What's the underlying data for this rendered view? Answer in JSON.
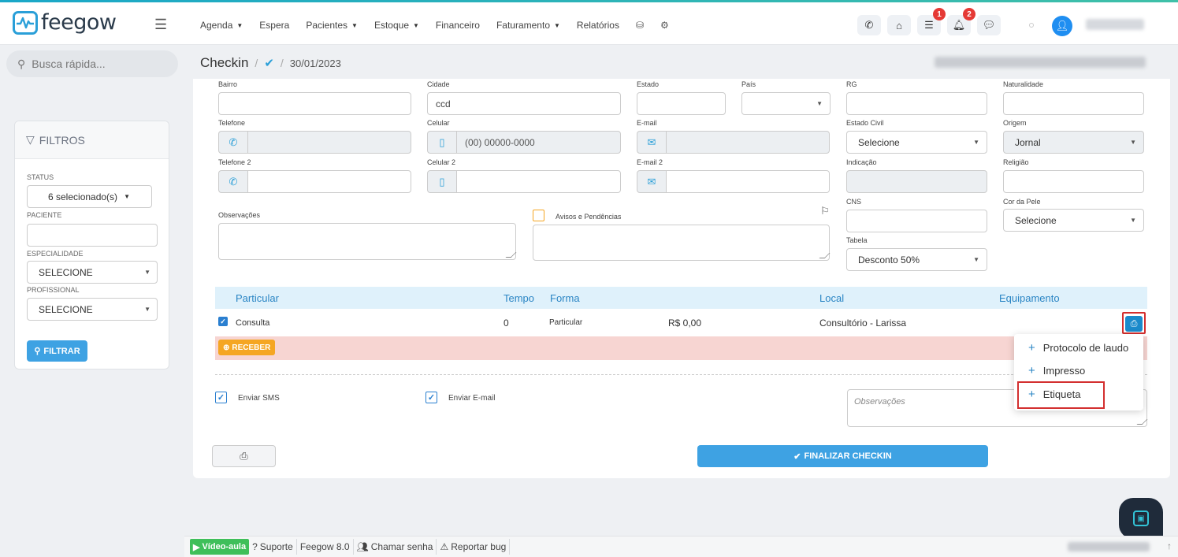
{
  "brand": {
    "name": "feegow"
  },
  "nav": {
    "items": [
      {
        "label": "Agenda",
        "has_caret": true
      },
      {
        "label": "Espera",
        "has_caret": false
      },
      {
        "label": "Pacientes",
        "has_caret": true
      },
      {
        "label": "Estoque",
        "has_caret": true
      },
      {
        "label": "Financeiro",
        "has_caret": false
      },
      {
        "label": "Faturamento",
        "has_caret": true
      },
      {
        "label": "Relatórios",
        "has_caret": false
      }
    ],
    "icons": [
      "database-icon",
      "gear-icon"
    ]
  },
  "header_badges": {
    "tasks": "1",
    "notifications": "2"
  },
  "search": {
    "placeholder": "Busca rápida..."
  },
  "filters": {
    "title": "FILTROS",
    "status_label": "STATUS",
    "status_value": "6 selecionado(s)",
    "paciente_label": "PACIENTE",
    "especialidade_label": "ESPECIALIDADE",
    "especialidade_value": "SELECIONE",
    "profissional_label": "PROFISSIONAL",
    "profissional_value": "SELECIONE",
    "filter_button": "FILTRAR"
  },
  "breadcrumb": {
    "title": "Checkin",
    "sep": "/",
    "date": "30/01/2023"
  },
  "form": {
    "bairro": "Bairro",
    "cidade": "Cidade",
    "cidade_value": "ccd",
    "estado": "Estado",
    "pais": "País",
    "rg": "RG",
    "naturalidade": "Naturalidade",
    "telefone": "Telefone",
    "celular": "Celular",
    "celular_placeholder": "(00) 00000-0000",
    "email": "E-mail",
    "estado_civil": "Estado Civil",
    "estado_civil_value": "Selecione",
    "origem": "Origem",
    "origem_value": "Jornal",
    "telefone2": "Telefone 2",
    "celular2": "Celular 2",
    "email2": "E-mail 2",
    "indicacao": "Indicação",
    "religiao": "Religião",
    "cns": "CNS",
    "cor_pele": "Cor da Pele",
    "cor_pele_value": "Selecione",
    "observacoes": "Observações",
    "avisos": "Avisos e Pendências",
    "tabela": "Tabela",
    "tabela_value": "Desconto 50%"
  },
  "table": {
    "headers": {
      "particular": "Particular",
      "tempo": "Tempo",
      "forma": "Forma",
      "local": "Local",
      "equipamento": "Equipamento"
    },
    "row": {
      "procedimento": "Consulta",
      "tempo": "0",
      "forma": "Particular",
      "valor": "R$ 0,00",
      "local": "Consultório - Larissa"
    },
    "receber_label": "RECEBER"
  },
  "print_menu": {
    "items": [
      "Protocolo de laudo",
      "Impresso",
      "Etiqueta"
    ]
  },
  "bottom": {
    "enviar_sms": "Enviar SMS",
    "enviar_email": "Enviar E-mail",
    "observacoes_placeholder": "Observações",
    "finalizar": "FINALIZAR CHECKIN"
  },
  "footer": {
    "video": "Vídeo-aula",
    "suporte": "Suporte",
    "version": "Feegow 8.0",
    "chamar": "Chamar senha",
    "reportar": "Reportar bug"
  },
  "colors": {
    "accent": "#3ea2e3",
    "brand": "#2a9fd8",
    "danger": "#d32f2f",
    "warning": "#f5a623",
    "success": "#3fbf5a"
  }
}
